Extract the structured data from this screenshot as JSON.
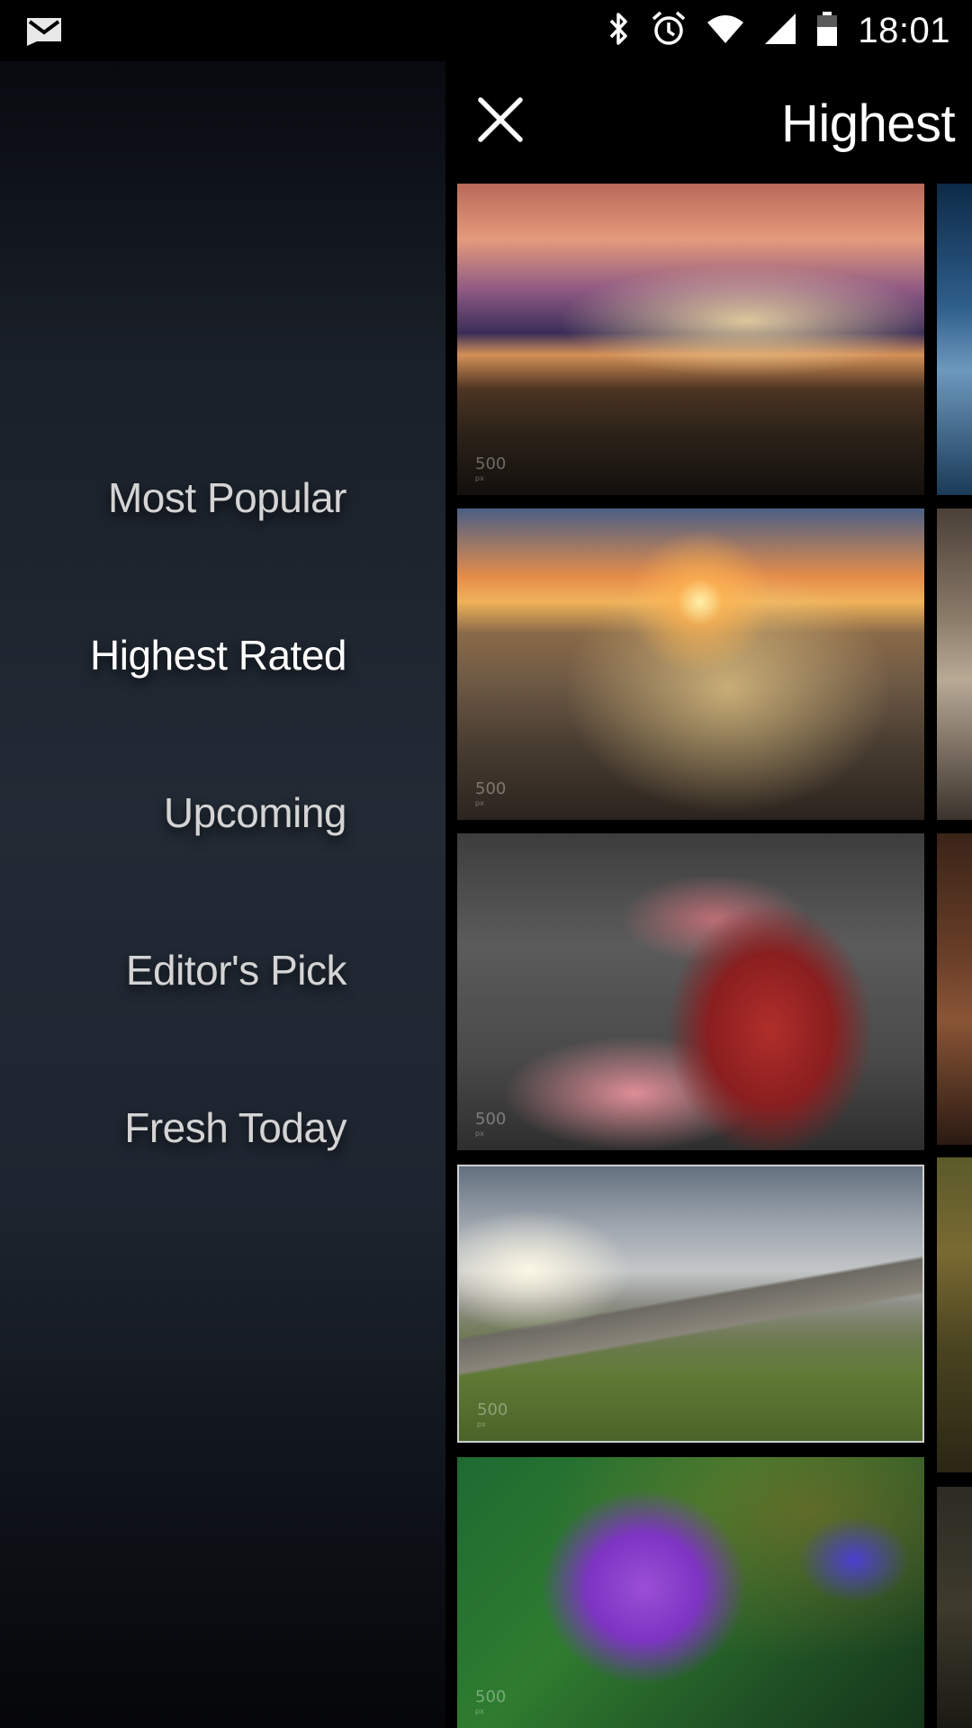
{
  "status_bar": {
    "time": "18:01",
    "icons": [
      "gmail-notification-icon",
      "bluetooth-icon",
      "alarm-icon",
      "wifi-icon",
      "cellular-signal-icon",
      "battery-icon"
    ]
  },
  "drawer": {
    "items": [
      {
        "label": "Most Popular",
        "active": false
      },
      {
        "label": "Highest Rated",
        "active": true
      },
      {
        "label": "Upcoming",
        "active": false
      },
      {
        "label": "Editor's Pick",
        "active": false
      },
      {
        "label": "Fresh Today",
        "active": false
      }
    ]
  },
  "app_bar": {
    "title": "Highest Rated",
    "close_icon": "close-icon"
  },
  "photos": [
    {
      "subject": "city-skyline-night-pier",
      "watermark": "500px"
    },
    {
      "subject": "rocky-coast-sunset",
      "watermark": "500px"
    },
    {
      "subject": "woman-flower-dress-forest",
      "watermark": "500px"
    },
    {
      "subject": "mountain-valley-clouds",
      "watermark": "500px"
    },
    {
      "subject": "purple-flower-macro",
      "watermark": "500px"
    }
  ],
  "colors": {
    "drawer_text": "#d4d4d4",
    "drawer_active_text": "#ffffff",
    "background": "#000000"
  }
}
